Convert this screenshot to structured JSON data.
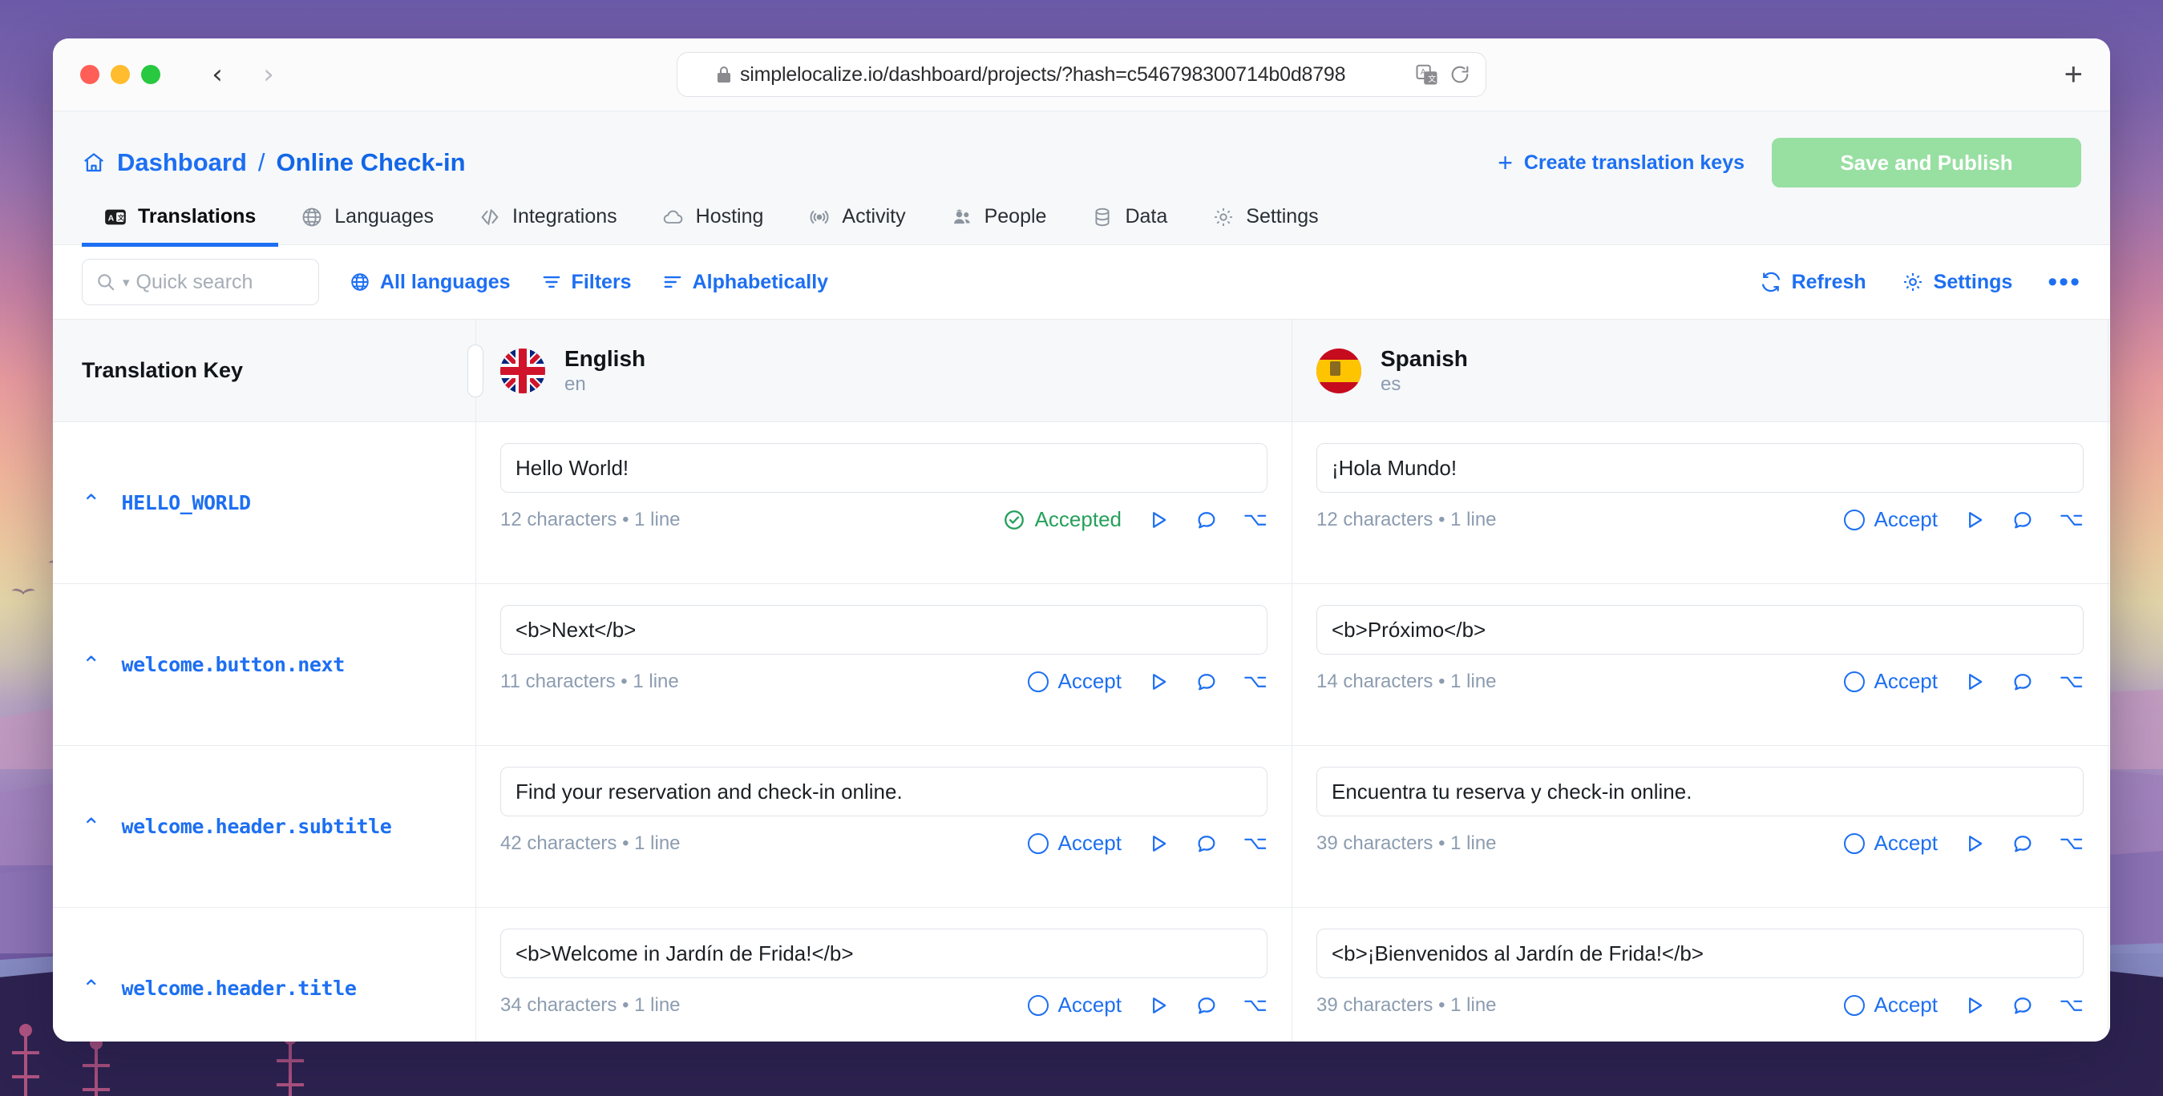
{
  "browser": {
    "url": "simplelocalize.io/dashboard/projects/?hash=c546798300714b0d8798",
    "back_label": "‹",
    "forward_label": "›",
    "new_tab_label": "+",
    "lock_icon": "lock-icon",
    "translate_icon": "translate-page-icon",
    "reload_icon": "reload-icon"
  },
  "header": {
    "breadcrumb": {
      "home_icon": "home-icon",
      "root": "Dashboard",
      "separator": "/",
      "current": "Online Check-in"
    },
    "create_keys_label": "Create translation keys",
    "create_keys_plus": "+",
    "save_publish_label": "Save and Publish",
    "save_publish_color": "#98dfa2",
    "accent_color": "#1d6ff2"
  },
  "tabs": [
    {
      "label": "Translations",
      "icon": "translations-icon",
      "active": true
    },
    {
      "label": "Languages",
      "icon": "globe-icon",
      "active": false
    },
    {
      "label": "Integrations",
      "icon": "code-brackets-icon",
      "active": false
    },
    {
      "label": "Hosting",
      "icon": "cloud-icon",
      "active": false
    },
    {
      "label": "Activity",
      "icon": "broadcast-icon",
      "active": false
    },
    {
      "label": "People",
      "icon": "people-icon",
      "active": false
    },
    {
      "label": "Data",
      "icon": "database-icon",
      "active": false
    },
    {
      "label": "Settings",
      "icon": "gear-icon",
      "active": false
    }
  ],
  "toolbar": {
    "search_placeholder": "Quick search",
    "search_value": "",
    "all_languages_label": "All languages",
    "filters_label": "Filters",
    "sort_label": "Alphabetically",
    "refresh_label": "Refresh",
    "settings_label": "Settings",
    "more_label": "•••"
  },
  "table": {
    "key_column_header": "Translation Key",
    "languages": [
      {
        "name": "English",
        "code": "en",
        "flag": "flag-uk"
      },
      {
        "name": "Spanish",
        "code": "es",
        "flag": "flag-es"
      }
    ],
    "accept_label": "Accept",
    "accepted_label": "Accepted",
    "accepted_color": "#25a05b",
    "rows": [
      {
        "key": "HELLO_WORLD",
        "en": {
          "value": "Hello World!",
          "meta": "12 characters • 1 line",
          "status": "Accepted",
          "accepted": true
        },
        "es": {
          "value": "¡Hola Mundo!",
          "meta": "12 characters • 1 line",
          "status": "Accept",
          "accepted": false
        }
      },
      {
        "key": "welcome.button.next",
        "en": {
          "value": "<b>Next</b>",
          "meta": "11 characters • 1 line",
          "status": "Accept",
          "accepted": false
        },
        "es": {
          "value": "<b>Próximo</b>",
          "meta": "14 characters • 1 line",
          "status": "Accept",
          "accepted": false
        }
      },
      {
        "key": "welcome.header.subtitle",
        "en": {
          "value": "Find your reservation and check-in online.",
          "meta": "42 characters • 1 line",
          "status": "Accept",
          "accepted": false
        },
        "es": {
          "value": "Encuentra tu reserva y check-in online.",
          "meta": "39 characters • 1 line",
          "status": "Accept",
          "accepted": false
        }
      },
      {
        "key": "welcome.header.title",
        "en": {
          "value": "<b>Welcome in Jardín de Frida!</b>",
          "meta": "34 characters • 1 line",
          "status": "Accept",
          "accepted": false
        },
        "es": {
          "value": "<b>¡Bienvenidos al Jardín de Frida!</b>",
          "meta": "39 characters • 1 line",
          "status": "Accept",
          "accepted": false
        }
      }
    ],
    "row_icons": [
      "play-icon",
      "comment-icon",
      "option-key-icon"
    ]
  }
}
